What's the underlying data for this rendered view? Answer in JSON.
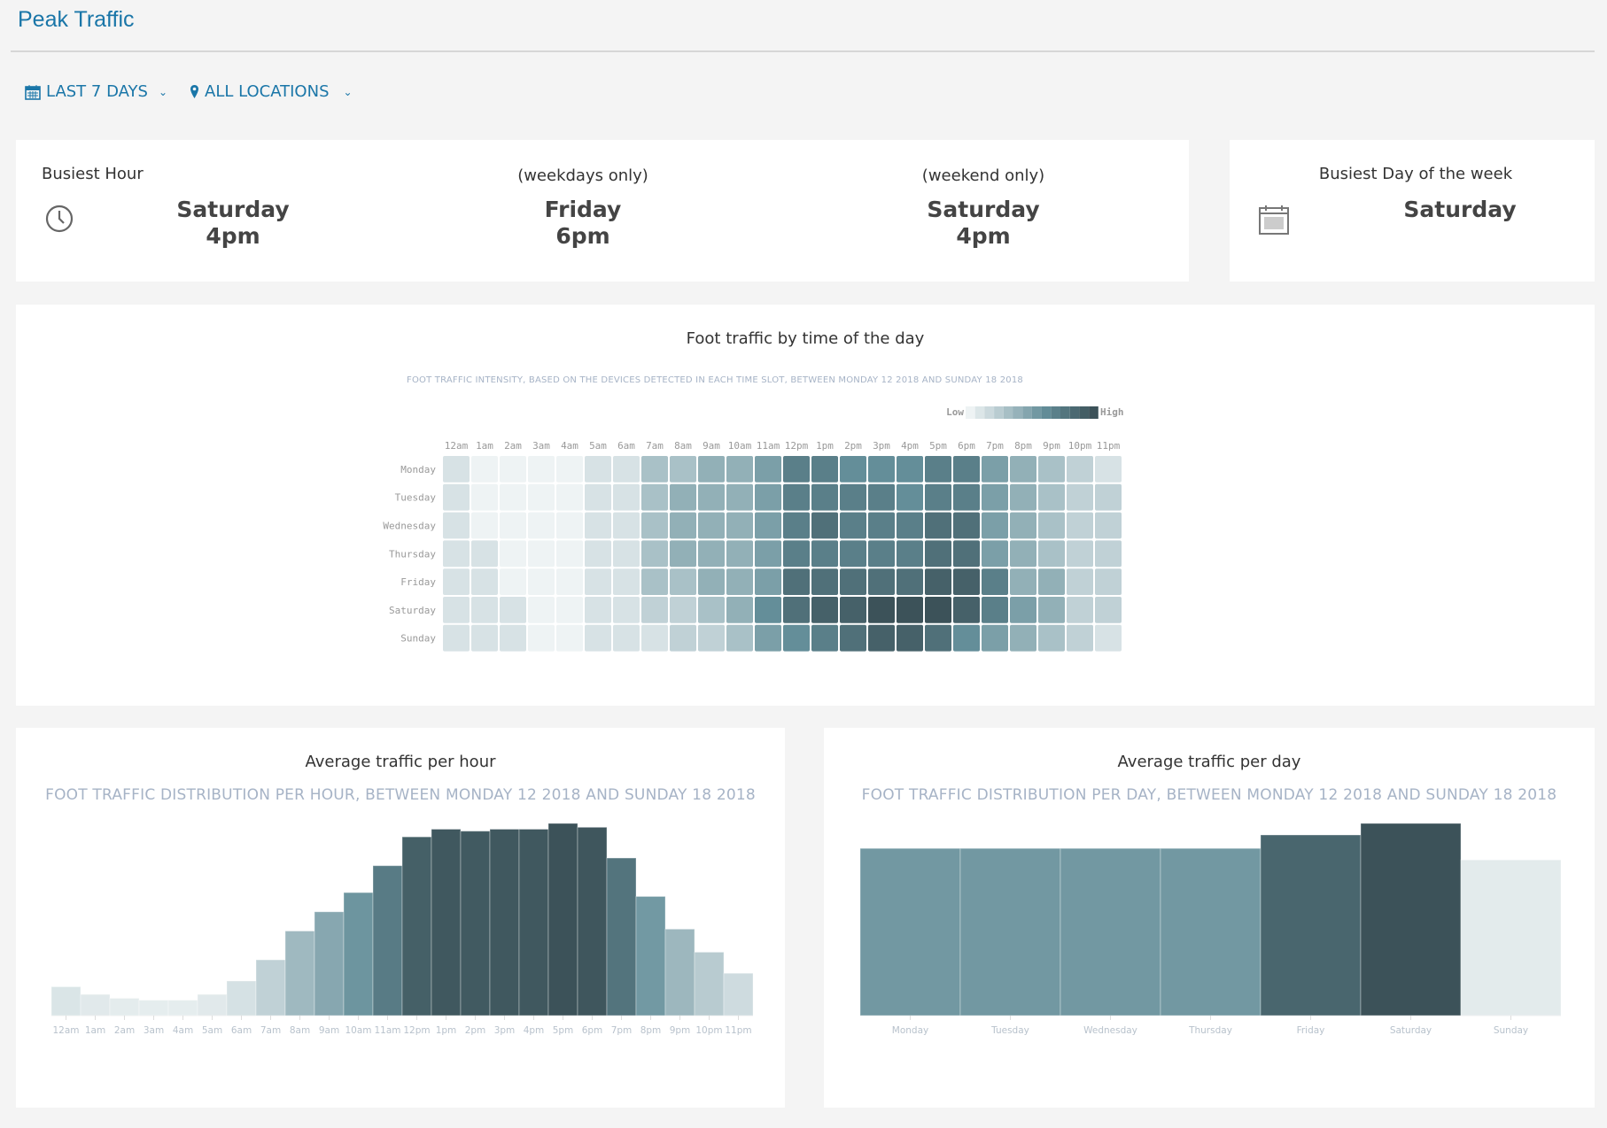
{
  "header": {
    "title": "Peak Traffic"
  },
  "filters": {
    "date_range": "LAST 7 DAYS",
    "location": "ALL LOCATIONS"
  },
  "busiest_hour": {
    "label": "Busiest Hour",
    "overall": {
      "day": "Saturday",
      "hour": "4pm"
    },
    "weekdays": {
      "label": "(weekdays only)",
      "day": "Friday",
      "hour": "6pm"
    },
    "weekend": {
      "label": "(weekend only)",
      "day": "Saturday",
      "hour": "4pm"
    }
  },
  "busiest_day": {
    "label": "Busiest Day of the week",
    "day": "Saturday"
  },
  "colors": {
    "accent": "#1a76a8",
    "low": "#eef3f4",
    "mid": "#648e99",
    "high": "#3c5259"
  },
  "chart_data": [
    {
      "type": "heatmap",
      "title": "Foot traffic by time of the day",
      "subtitle": "FOOT TRAFFIC INTENSITY, BASED ON THE DEVICES DETECTED IN EACH TIME SLOT, BETWEEN MONDAY 12 2018 AND SUNDAY 18 2018",
      "legend": {
        "low": "Low",
        "high": "High",
        "placement": "top-right"
      },
      "x": [
        "12am",
        "1am",
        "2am",
        "3am",
        "4am",
        "5am",
        "6am",
        "7am",
        "8am",
        "9am",
        "10am",
        "11am",
        "12pm",
        "1pm",
        "2pm",
        "3pm",
        "4pm",
        "5pm",
        "6pm",
        "7pm",
        "8pm",
        "9pm",
        "10pm",
        "11pm"
      ],
      "y": [
        "Monday",
        "Tuesday",
        "Wednesday",
        "Thursday",
        "Friday",
        "Saturday",
        "Sunday"
      ],
      "scale": [
        0,
        10
      ],
      "values": [
        [
          1,
          0,
          0,
          0,
          0,
          1,
          1,
          3,
          3,
          4,
          4,
          5,
          7,
          7,
          6,
          6,
          6,
          7,
          7,
          5,
          4,
          3,
          2,
          1
        ],
        [
          1,
          0,
          0,
          0,
          0,
          1,
          1,
          3,
          4,
          4,
          4,
          5,
          7,
          7,
          7,
          7,
          6,
          7,
          7,
          5,
          4,
          3,
          2,
          2
        ],
        [
          1,
          0,
          0,
          0,
          0,
          1,
          1,
          3,
          4,
          4,
          4,
          5,
          7,
          8,
          7,
          7,
          7,
          8,
          8,
          5,
          4,
          3,
          2,
          2
        ],
        [
          1,
          1,
          0,
          0,
          0,
          1,
          1,
          3,
          4,
          4,
          4,
          5,
          7,
          7,
          7,
          7,
          7,
          8,
          8,
          5,
          4,
          3,
          2,
          2
        ],
        [
          1,
          1,
          0,
          0,
          0,
          1,
          1,
          3,
          3,
          4,
          4,
          5,
          8,
          8,
          8,
          8,
          8,
          9,
          9,
          7,
          4,
          4,
          2,
          2
        ],
        [
          1,
          1,
          1,
          0,
          0,
          1,
          1,
          2,
          2,
          3,
          4,
          6,
          8,
          9,
          9,
          10,
          10,
          10,
          9,
          7,
          5,
          4,
          2,
          2
        ],
        [
          1,
          1,
          1,
          0,
          0,
          1,
          1,
          1,
          2,
          2,
          3,
          5,
          6,
          7,
          8,
          9,
          9,
          8,
          6,
          5,
          4,
          3,
          2,
          1
        ]
      ]
    },
    {
      "type": "bar",
      "title": "Average traffic per hour",
      "subtitle": "FOOT TRAFFIC DISTRIBUTION PER HOUR, BETWEEN MONDAY 12 2018 AND SUNDAY 18 2018",
      "categories": [
        "12am",
        "1am",
        "2am",
        "3am",
        "4am",
        "5am",
        "6am",
        "7am",
        "8am",
        "9am",
        "10am",
        "11am",
        "12pm",
        "1pm",
        "2pm",
        "3pm",
        "4pm",
        "5pm",
        "6pm",
        "7pm",
        "8pm",
        "9pm",
        "10pm",
        "11pm"
      ],
      "values": [
        15,
        11,
        9,
        8,
        8,
        11,
        18,
        29,
        44,
        54,
        64,
        78,
        93,
        97,
        96,
        97,
        97,
        100,
        98,
        82,
        62,
        45,
        33,
        22
      ],
      "ylim": [
        0,
        100
      ]
    },
    {
      "type": "bar",
      "title": "Average traffic per day",
      "subtitle": "FOOT TRAFFIC DISTRIBUTION PER DAY, BETWEEN MONDAY 12 2018 AND SUNDAY 18 2018",
      "categories": [
        "Monday",
        "Tuesday",
        "Wednesday",
        "Thursday",
        "Friday",
        "Saturday",
        "Sunday"
      ],
      "values": [
        87,
        87,
        87,
        87,
        94,
        100,
        81
      ],
      "ylim": [
        0,
        100
      ]
    }
  ]
}
